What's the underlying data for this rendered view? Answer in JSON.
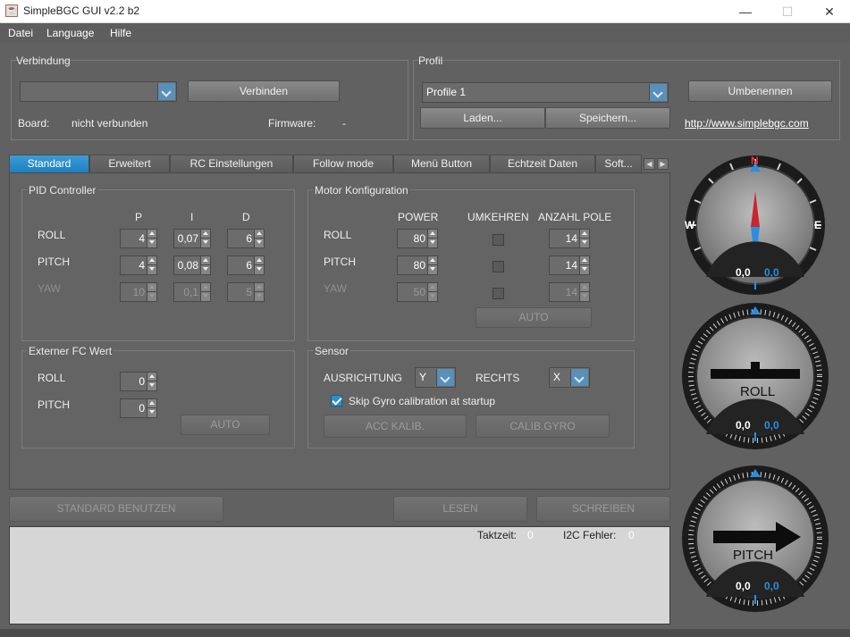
{
  "window": {
    "title": "SimpleBGC GUI v2.2 b2",
    "minimize": "—",
    "maximize": "☐",
    "close": "✕"
  },
  "menu": [
    "Datei",
    "Language",
    "Hilfe"
  ],
  "connection": {
    "group_label": "Verbindung",
    "port_value": "",
    "connect_button": "Verbinden",
    "board_label": "Board:",
    "board_value": "nicht verbunden",
    "firmware_label": "Firmware:",
    "firmware_value": "-"
  },
  "profile": {
    "group_label": "Profil",
    "selected": "Profile 1",
    "rename_button": "Umbenennen",
    "load_button": "Laden...",
    "save_button": "Speichern...",
    "website": "http://www.simplebgc.com"
  },
  "tabs": [
    "Standard",
    "Erweitert",
    "RC Einstellungen",
    "Follow mode",
    "Menü Button",
    "Echtzeit Daten",
    "Soft..."
  ],
  "pid": {
    "group_label": "PID Controller",
    "col_p": "P",
    "col_i": "I",
    "col_d": "D",
    "rows": [
      {
        "label": "ROLL",
        "p": "4",
        "i": "0,07",
        "d": "6"
      },
      {
        "label": "PITCH",
        "p": "4",
        "i": "0,08",
        "d": "6"
      },
      {
        "label": "YAW",
        "p": "10",
        "i": "0,1",
        "d": "5"
      }
    ]
  },
  "motor": {
    "group_label": "Motor Konfiguration",
    "col_power": "POWER",
    "col_reverse": "UMKEHREN",
    "col_poles": "ANZAHL POLE",
    "rows": [
      {
        "label": "ROLL",
        "power": "80",
        "reverse": false,
        "poles": "14"
      },
      {
        "label": "PITCH",
        "power": "80",
        "reverse": false,
        "poles": "14"
      },
      {
        "label": "YAW",
        "power": "50",
        "reverse": false,
        "poles": "14"
      }
    ],
    "auto_button": "AUTO"
  },
  "external_fc": {
    "group_label": "Externer FC Wert",
    "roll_label": "ROLL",
    "roll_value": "0",
    "pitch_label": "PITCH",
    "pitch_value": "0",
    "auto_button": "AUTO"
  },
  "sensor": {
    "group_label": "Sensor",
    "orientation_label": "AUSRICHTUNG",
    "orientation_value": "Y",
    "right_label": "RECHTS",
    "right_value": "X",
    "skip_gyro_label": "Skip Gyro calibration at startup",
    "skip_gyro_checked": true,
    "acc_calib_button": "ACC KALIB.",
    "gyro_calib_button": "CALIB.GYRO"
  },
  "actions": {
    "use_defaults": "STANDARD BENUTZEN",
    "read": "LESEN",
    "write": "SCHREIBEN"
  },
  "status": {
    "cycle_label": "Taktzeit:",
    "cycle_value": "0",
    "i2c_label": "I2C Fehler:",
    "i2c_value": "0"
  },
  "gauges": {
    "compass": {
      "n": "N",
      "w": "W",
      "e": "E",
      "value_a": "0,0",
      "value_b": "0,0"
    },
    "roll": {
      "label": "ROLL",
      "value_a": "0,0",
      "value_b": "0,0"
    },
    "pitch": {
      "label": "PITCH",
      "value_a": "0,0",
      "value_b": "0,0"
    }
  },
  "colors": {
    "accent": "#2d8fd0",
    "background": "#616161",
    "gauge_blue": "#2a8fe0"
  }
}
